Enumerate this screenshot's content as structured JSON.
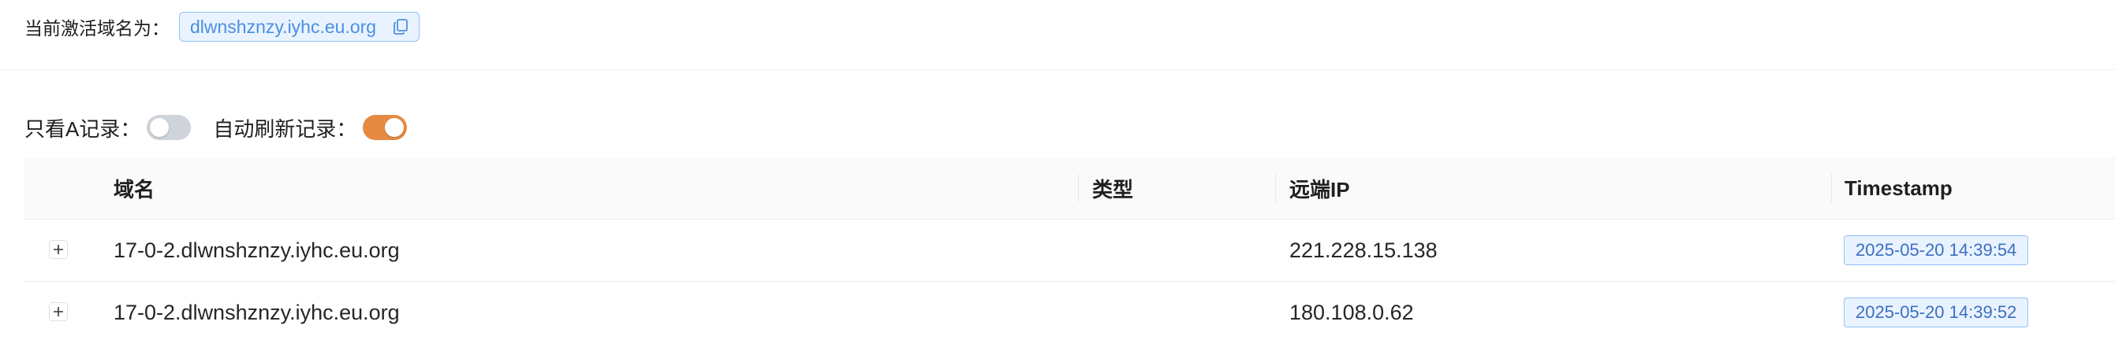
{
  "header": {
    "active_domain_label": "当前激活域名为：",
    "active_domain": "dlwnshznzy.iyhc.eu.org",
    "copy_icon": "copy-icon"
  },
  "filters": {
    "only_a_label": "只看A记录：",
    "only_a_enabled": false,
    "auto_refresh_label": "自动刷新记录：",
    "auto_refresh_enabled": true
  },
  "table": {
    "columns": [
      "域名",
      "类型",
      "远端IP",
      "Timestamp"
    ],
    "rows": [
      {
        "domain": "17-0-2.dlwnshznzy.iyhc.eu.org",
        "type": "",
        "remote_ip": "221.228.15.138",
        "timestamp": "2025-05-20 14:39:54"
      },
      {
        "domain": "17-0-2.dlwnshznzy.iyhc.eu.org",
        "type": "",
        "remote_ip": "180.108.0.62",
        "timestamp": "2025-05-20 14:39:52"
      }
    ]
  },
  "colors": {
    "accent_toggle_on": "#e68a43",
    "toggle_off": "#cfd3da",
    "tag_border": "#91c0f5",
    "tag_background": "#e9f3ff",
    "tag_text": "#3c6fc2"
  }
}
